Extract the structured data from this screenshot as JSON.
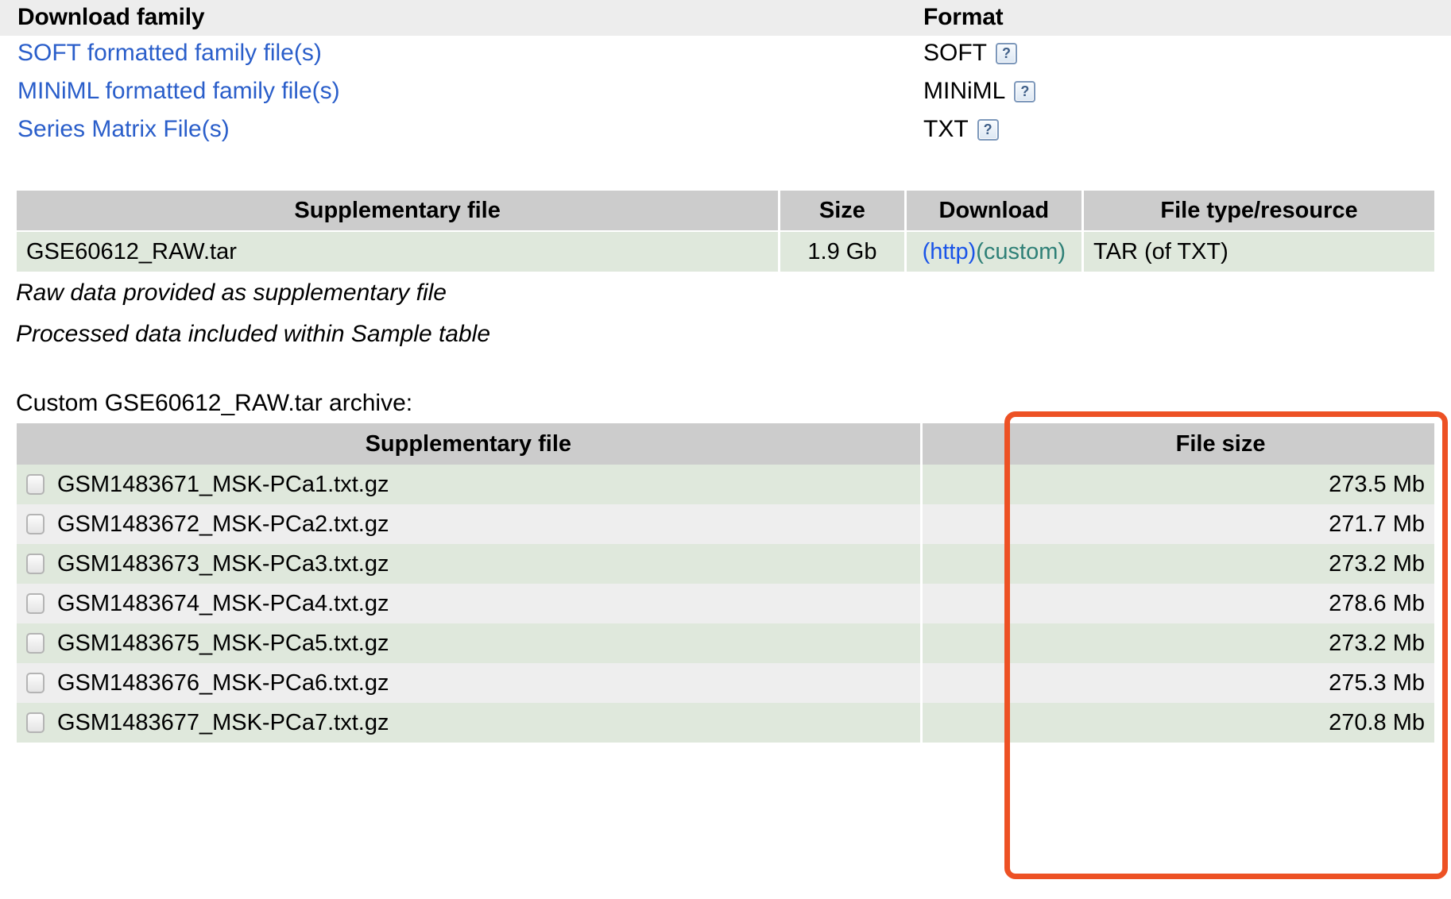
{
  "download_family": {
    "headers": {
      "name": "Download family",
      "format": "Format"
    },
    "rows": [
      {
        "label": "SOFT formatted family file(s)",
        "format": "SOFT",
        "help_icon": "help-icon"
      },
      {
        "label": "MINiML formatted family file(s)",
        "format": "MINiML",
        "help_icon": "help-icon"
      },
      {
        "label": "Series Matrix File(s)",
        "format": "TXT",
        "help_icon": "help-icon"
      }
    ]
  },
  "supplementary_table": {
    "headers": {
      "file": "Supplementary file",
      "size": "Size",
      "download": "Download",
      "type": "File type/resource"
    },
    "rows": [
      {
        "file": "GSE60612_RAW.tar",
        "size": "1.9 Gb",
        "download_http": "(http)",
        "download_custom": "(custom)",
        "type": "TAR (of TXT)"
      }
    ]
  },
  "notes": [
    "Raw data provided as supplementary file",
    "Processed data included within Sample table"
  ],
  "custom_archive": {
    "caption": "Custom GSE60612_RAW.tar archive:",
    "headers": {
      "file": "Supplementary file",
      "size": "File size"
    },
    "rows": [
      {
        "file": "GSM1483671_MSK-PCa1.txt.gz",
        "size": "273.5 Mb"
      },
      {
        "file": "GSM1483672_MSK-PCa2.txt.gz",
        "size": "271.7 Mb"
      },
      {
        "file": "GSM1483673_MSK-PCa3.txt.gz",
        "size": "273.2 Mb"
      },
      {
        "file": "GSM1483674_MSK-PCa4.txt.gz",
        "size": "278.6 Mb"
      },
      {
        "file": "GSM1483675_MSK-PCa5.txt.gz",
        "size": "273.2 Mb"
      },
      {
        "file": "GSM1483676_MSK-PCa6.txt.gz",
        "size": "275.3 Mb"
      },
      {
        "file": "GSM1483677_MSK-PCa7.txt.gz",
        "size": "270.8 Mb"
      }
    ]
  },
  "colors": {
    "link_blue": "#2a5eca",
    "custom_teal": "#2f8077",
    "row_green": "#dfe8dc",
    "row_gray": "#eeeeee",
    "header_gray": "#cccccc",
    "band_gray": "#ededed",
    "highlight_red": "#ed5124"
  }
}
